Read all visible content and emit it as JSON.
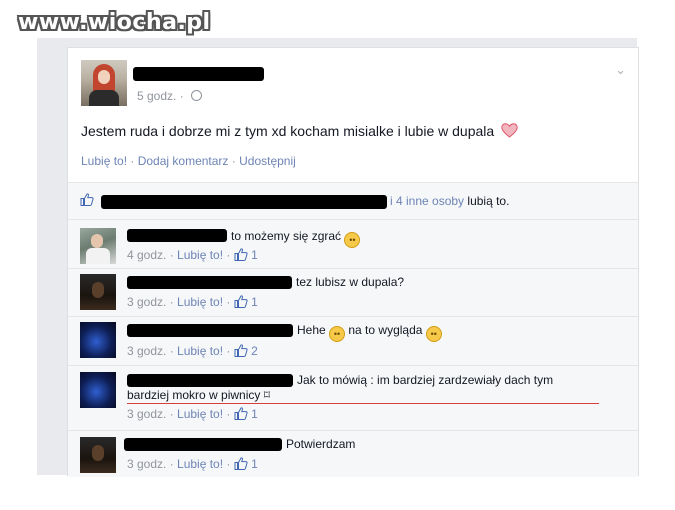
{
  "watermark": "www.wiocha.pl",
  "post": {
    "time": "5 godz. ·",
    "status_text": "Jestem ruda i dobrze mi z tym xd kocham misialke i lubie w dupala",
    "actions": {
      "like": "Lubię to!",
      "sep1": " · ",
      "comment": "Dodaj komentarz",
      "sep2": " · ",
      "share": "Udostępnij"
    },
    "likes_text_blue": "i 4 inne osoby",
    "likes_text_rest": "lubią to."
  },
  "comments": [
    {
      "text": "to możemy się zgrać",
      "time": "4 godz. · ",
      "like": "Lubię to!",
      "sep": " · ",
      "count": "1"
    },
    {
      "text": "tez lubisz w dupala?",
      "time": "3 godz. · ",
      "like": "Lubię to!",
      "sep": " · ",
      "count": "1"
    },
    {
      "text_a": "Hehe",
      "text_b": "na to wygląda",
      "time": "3 godz. · ",
      "like": "Lubię to!",
      "sep": " · ",
      "count": "2"
    },
    {
      "text_line1": "Jak to mówią : im bardziej zardzewiały dach tym",
      "text_line2": "bardziej mokro w piwnicy ⌑",
      "time": "3 godz. · ",
      "like": "Lubię to!",
      "sep": " · ",
      "count": "1"
    },
    {
      "text": "Potwierdzam",
      "time": "3 godz. · ",
      "like": "Lubię to!",
      "sep": " · ",
      "count": "1"
    }
  ],
  "colors": {
    "link": "#6d84b4",
    "meta": "#90949c",
    "heart": "#e0576b",
    "emoji": "#f7c948"
  },
  "icons": [
    "globe-icon",
    "chevron-down-icon",
    "heart-icon",
    "thumbs-up-icon",
    "emoji-icon"
  ]
}
